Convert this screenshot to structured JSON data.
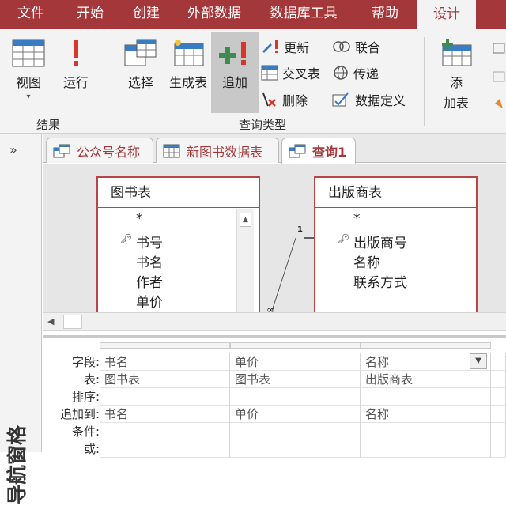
{
  "menu": {
    "tabs": [
      "文件",
      "开始",
      "创建",
      "外部数据",
      "数据库工具",
      "帮助",
      "设计"
    ],
    "active": "设计"
  },
  "ribbon": {
    "results_group": {
      "label": "结果",
      "view": "视图",
      "run": "运行"
    },
    "query_type_group": {
      "label": "查询类型",
      "select": "选择",
      "make_table": "生成表",
      "append": "追加",
      "update": "更新",
      "crosstab": "交叉表",
      "delete": "删除",
      "union": "联合",
      "passthrough": "传递",
      "data_definition": "数据定义"
    },
    "query_setup": {
      "add_table_line1": "添",
      "add_table_line2": "加表"
    }
  },
  "nav": {
    "toggle": "»",
    "label": "导航窗格"
  },
  "doc_tabs": [
    {
      "label": "公众号名称",
      "icon": "query-icon"
    },
    {
      "label": "新图书数据表",
      "icon": "table-icon"
    },
    {
      "label": "查询1",
      "icon": "query-icon",
      "active": true
    }
  ],
  "design": {
    "tables": [
      {
        "title": "图书表",
        "fields": [
          "*",
          "书号",
          "书名",
          "作者",
          "单价"
        ],
        "key_field": "书号"
      },
      {
        "title": "出版商表",
        "fields": [
          "*",
          "出版商号",
          "名称",
          "联系方式"
        ],
        "key_field": "出版商号"
      }
    ],
    "relation_label": "1",
    "relation_many": "∞"
  },
  "grid": {
    "row_headers": [
      "字段:",
      "表:",
      "排序:",
      "追加到:",
      "条件:",
      "或:"
    ],
    "columns": [
      {
        "field": "书名",
        "table": "图书表",
        "sort": "",
        "append_to": "书名"
      },
      {
        "field": "单价",
        "table": "图书表",
        "sort": "",
        "append_to": "单价"
      },
      {
        "field": "名称",
        "table": "出版商表",
        "sort": "",
        "append_to": "名称"
      }
    ]
  }
}
